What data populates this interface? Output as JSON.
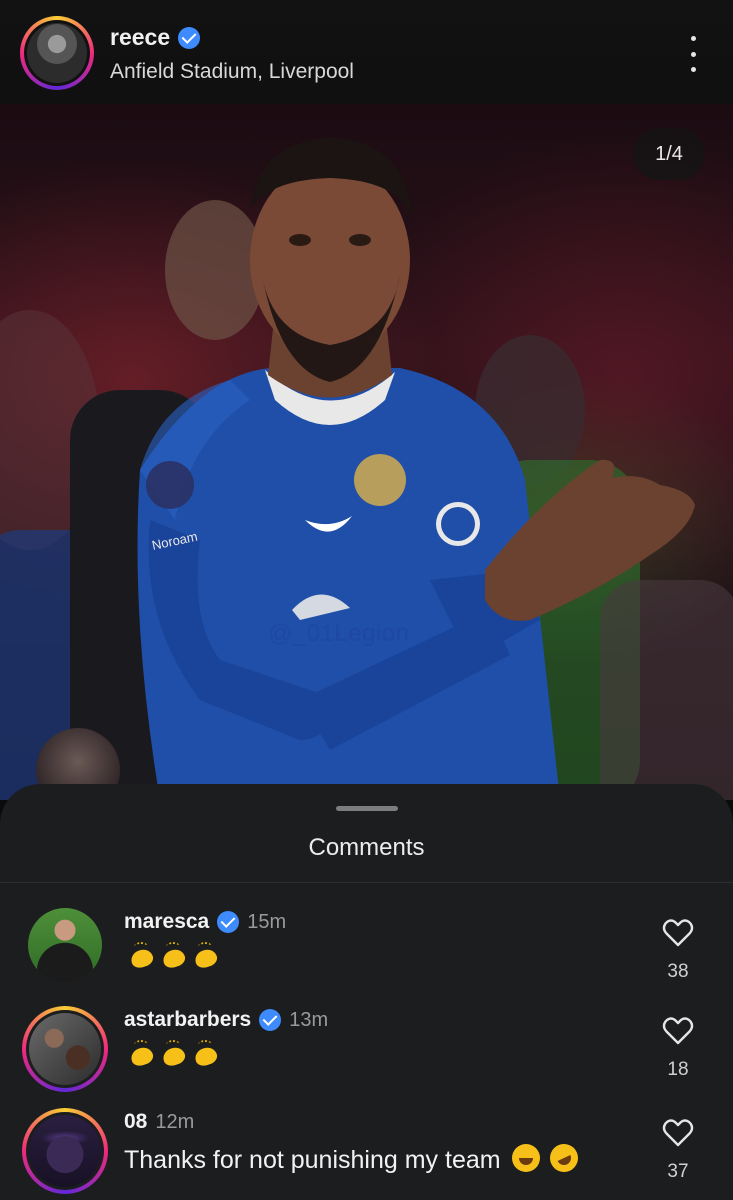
{
  "header": {
    "username": "reece",
    "verified": true,
    "location": "Anfield Stadium, Liverpool",
    "more_icon": "more-vertical-icon"
  },
  "post": {
    "counter": "1/4",
    "watermark": "@_01Legion"
  },
  "comments_sheet": {
    "title": "Comments",
    "items": [
      {
        "username": "maresca",
        "verified": true,
        "time": "15m",
        "emoji": [
          "clapping-hands",
          "clapping-hands",
          "clapping-hands"
        ],
        "likes": "38",
        "story_ring": false
      },
      {
        "username": "astarbarbers",
        "verified": true,
        "time": "13m",
        "emoji": [
          "clapping-hands",
          "clapping-hands",
          "clapping-hands"
        ],
        "likes": "18",
        "story_ring": true
      },
      {
        "username": "08",
        "verified": false,
        "time": "12m",
        "text": "Thanks for not punishing my team",
        "emoji": [
          "sweat-smile",
          "rolling-laugh"
        ],
        "likes": "37",
        "story_ring": true
      }
    ]
  },
  "colors": {
    "verified_blue": "#3d8bfd",
    "sheet_bg": "#1c1d1f",
    "kit_blue": "#1f4fa8"
  }
}
